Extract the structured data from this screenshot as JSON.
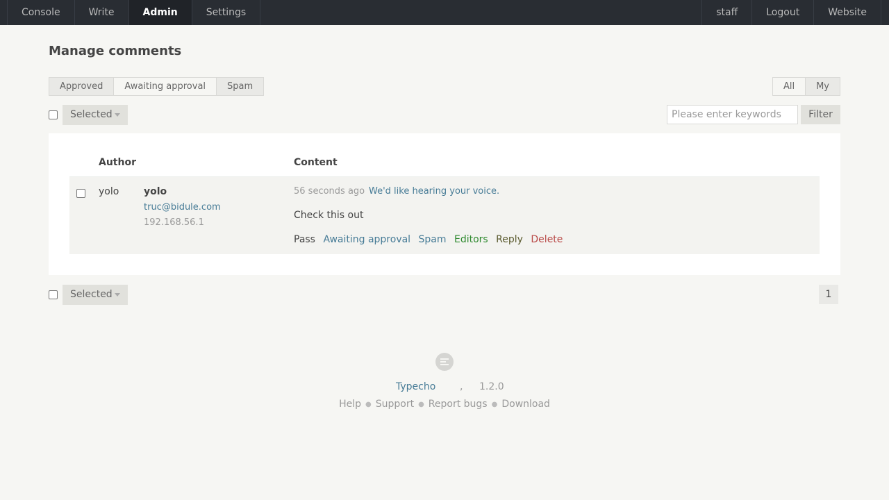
{
  "nav": {
    "left": [
      "Console",
      "Write",
      "Admin",
      "Settings"
    ],
    "active": "Admin",
    "right": [
      "staff",
      "Logout",
      "Website"
    ]
  },
  "page": {
    "title": "Manage comments"
  },
  "status_tabs": [
    "Approved",
    "Awaiting approval",
    "Spam"
  ],
  "scope_tabs": [
    "All",
    "My"
  ],
  "actions": {
    "selected_label": "Selected",
    "search_placeholder": "Please enter keywords",
    "filter_label": "Filter"
  },
  "table": {
    "headers": {
      "author": "Author",
      "content": "Content"
    },
    "row": {
      "avatar_alt": "yolo",
      "author": "yolo",
      "email": "truc@bidule.com",
      "ip": "192.168.56.1",
      "time": "56 seconds ago",
      "post": "We'd like hearing your voice.",
      "text": "Check this out",
      "ops": {
        "pass": "Pass",
        "awaiting": "Awaiting approval",
        "spam": "Spam",
        "editors": "Editors",
        "reply": "Reply",
        "delete": "Delete"
      }
    }
  },
  "pagination": {
    "current": "1"
  },
  "footer": {
    "brand": "Typecho",
    "comma": ",",
    "version": "1.2.0",
    "links": [
      "Help",
      "Support",
      "Report bugs",
      "Download"
    ]
  }
}
